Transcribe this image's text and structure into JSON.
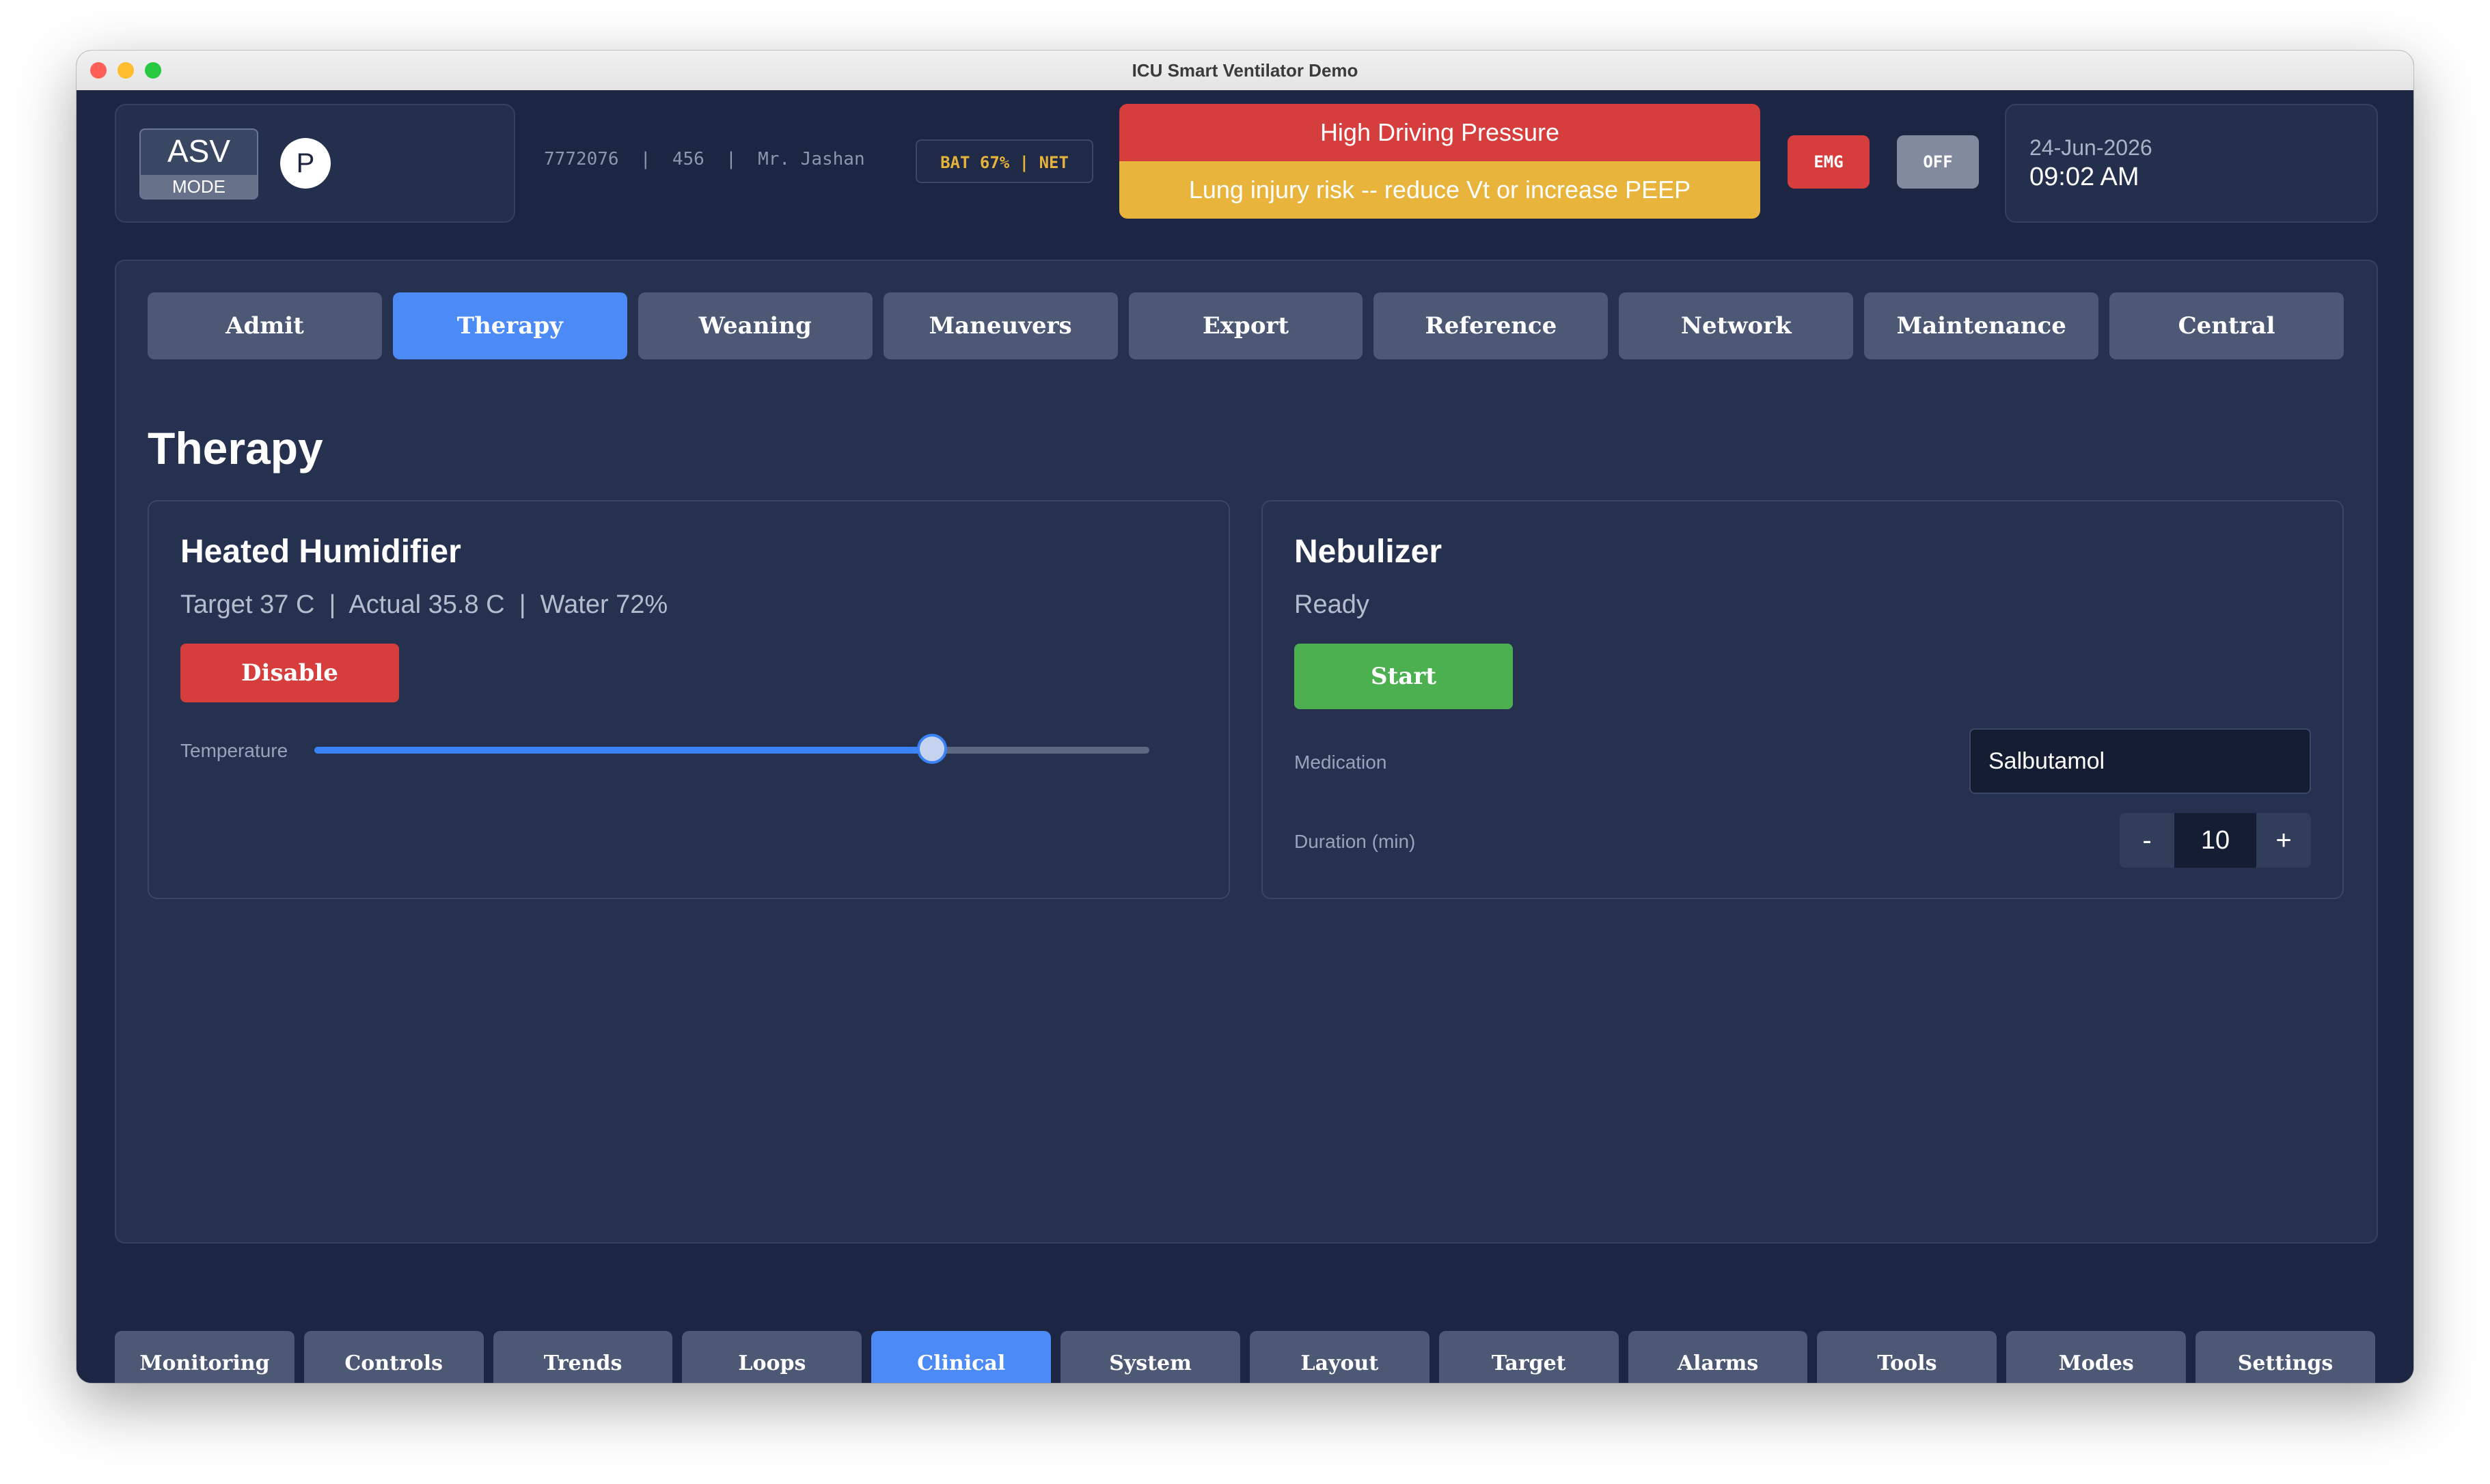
{
  "window": {
    "title": "ICU Smart Ventilator Demo"
  },
  "header": {
    "mode": {
      "name": "ASV",
      "label": "MODE"
    },
    "patient_badge": "P",
    "patient_info": "7772076  |  456  |  Mr. Jashan",
    "status_chip": "BAT 67% | NET",
    "alarm": {
      "title": "High Driving Pressure",
      "message": "Lung injury risk -- reduce Vt or increase PEEP",
      "title_color": "#d63e3e",
      "message_color": "#e8b43c"
    },
    "emg_label": "EMG",
    "off_label": "OFF",
    "date": "24-Jun-2026",
    "time": "09:02 AM"
  },
  "tabs": [
    {
      "label": "Admit"
    },
    {
      "label": "Therapy",
      "active": true
    },
    {
      "label": "Weaning"
    },
    {
      "label": "Maneuvers"
    },
    {
      "label": "Export"
    },
    {
      "label": "Reference"
    },
    {
      "label": "Network"
    },
    {
      "label": "Maintenance"
    },
    {
      "label": "Central"
    }
  ],
  "page_title": "Therapy",
  "humidifier": {
    "title": "Heated Humidifier",
    "status": "Target 37 C  |  Actual 35.8 C  |  Water 72%",
    "disable_label": "Disable",
    "temperature_label": "Temperature",
    "temperature_slider_fraction": 0.74
  },
  "nebulizer": {
    "title": "Nebulizer",
    "status": "Ready",
    "start_label": "Start",
    "medication_label": "Medication",
    "medication_value": "Salbutamol",
    "duration_label": "Duration (min)",
    "duration_value": "10",
    "minus_label": "-",
    "plus_label": "+"
  },
  "bottom_nav": [
    {
      "label": "Monitoring"
    },
    {
      "label": "Controls"
    },
    {
      "label": "Trends"
    },
    {
      "label": "Loops"
    },
    {
      "label": "Clinical",
      "active": true
    },
    {
      "label": "System"
    },
    {
      "label": "Layout"
    },
    {
      "label": "Target"
    },
    {
      "label": "Alarms"
    },
    {
      "label": "Tools"
    },
    {
      "label": "Modes"
    },
    {
      "label": "Settings"
    }
  ],
  "colors": {
    "background": "#1c2541",
    "panel": "#263150",
    "accent": "#4c8bf5",
    "danger": "#d63e3e",
    "warning": "#e8b43c",
    "success": "#4caf50"
  }
}
